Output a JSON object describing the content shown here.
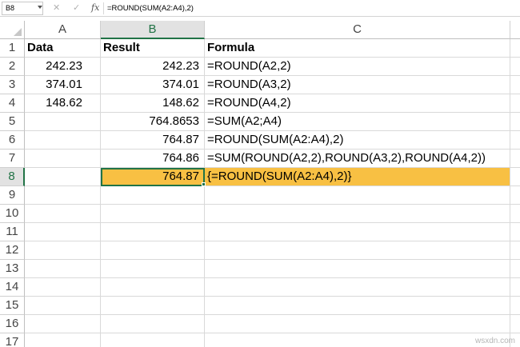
{
  "formula_bar": {
    "name_box": "B8",
    "cancel_icon": "✕",
    "enter_icon": "✓",
    "fx_label": "fx",
    "formula": "=ROUND(SUM(A2:A4),2)"
  },
  "columns": [
    "A",
    "B",
    "C"
  ],
  "rows": [
    {
      "num": "1",
      "a": "Data",
      "b": "Result",
      "c": "Formula"
    },
    {
      "num": "2",
      "a": "242.23",
      "b": "242.23",
      "c": "=ROUND(A2,2)"
    },
    {
      "num": "3",
      "a": "374.01",
      "b": "374.01",
      "c": "=ROUND(A3,2)"
    },
    {
      "num": "4",
      "a": "148.62",
      "b": "148.62",
      "c": "=ROUND(A4,2)"
    },
    {
      "num": "5",
      "a": "",
      "b": "764.8653",
      "c": "=SUM(A2;A4)"
    },
    {
      "num": "6",
      "a": "",
      "b": "764.87",
      "c": "=ROUND(SUM(A2:A4),2)"
    },
    {
      "num": "7",
      "a": "",
      "b": "764.86",
      "c": "=SUM(ROUND(A2,2),ROUND(A3,2),ROUND(A4,2))"
    },
    {
      "num": "8",
      "a": "",
      "b": "764.87",
      "c": "{=ROUND(SUM(A2:A4),2)}"
    },
    {
      "num": "9",
      "a": "",
      "b": "",
      "c": ""
    },
    {
      "num": "10",
      "a": "",
      "b": "",
      "c": ""
    },
    {
      "num": "11",
      "a": "",
      "b": "",
      "c": ""
    },
    {
      "num": "12",
      "a": "",
      "b": "",
      "c": ""
    },
    {
      "num": "13",
      "a": "",
      "b": "",
      "c": ""
    },
    {
      "num": "14",
      "a": "",
      "b": "",
      "c": ""
    },
    {
      "num": "15",
      "a": "",
      "b": "",
      "c": ""
    },
    {
      "num": "16",
      "a": "",
      "b": "",
      "c": ""
    },
    {
      "num": "17",
      "a": "",
      "b": "",
      "c": ""
    }
  ],
  "selection": {
    "active_cell": "B8",
    "highlight_color": "#f8c043",
    "accent": "#217346"
  },
  "watermark": "wsxdn.com"
}
